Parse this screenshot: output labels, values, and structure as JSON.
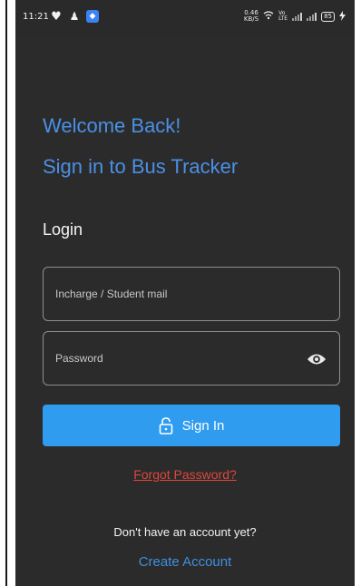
{
  "status_bar": {
    "time": "11:21",
    "speed_value": "0.46",
    "speed_unit": "KB/S",
    "battery": "85"
  },
  "header": {
    "welcome": "Welcome Back!",
    "subtitle": "Sign in to Bus Tracker"
  },
  "form": {
    "section_label": "Login",
    "email_placeholder": "Incharge / Student mail",
    "email_value": "",
    "password_placeholder": "Password",
    "password_value": "",
    "signin_label": "Sign In",
    "forgot_label": "Forgot Password?"
  },
  "footer": {
    "no_account_text": "Don't have an account yet?",
    "create_account_label": "Create Account"
  },
  "colors": {
    "background": "#2b2b2b",
    "accent_blue": "#4a90e6",
    "button_blue": "#2f9cf0",
    "link_red": "#e0463c"
  },
  "icons": {
    "password_toggle": "eye-icon",
    "signin": "lock-icon"
  }
}
